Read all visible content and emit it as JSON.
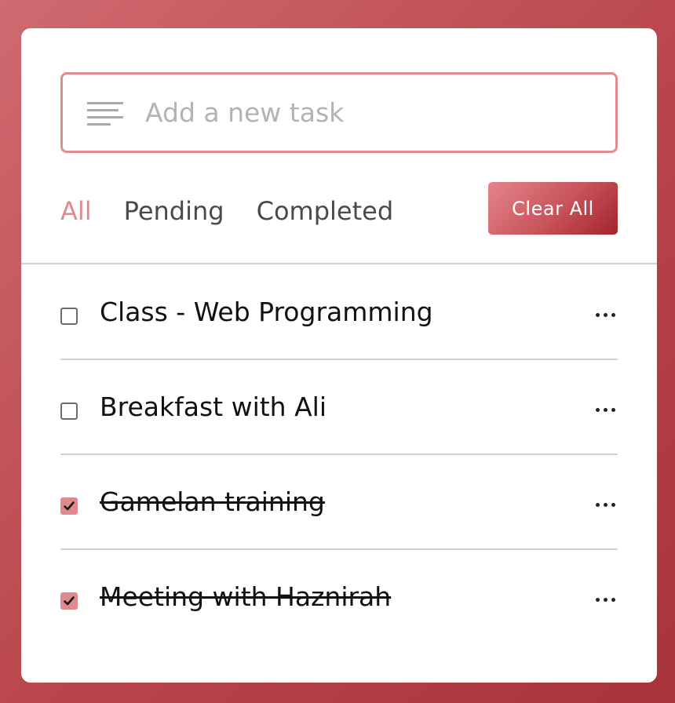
{
  "input": {
    "placeholder": "Add a new task",
    "value": "",
    "icon": "text-lines-icon"
  },
  "filters": [
    {
      "label": "All",
      "active": true
    },
    {
      "label": "Pending",
      "active": false
    },
    {
      "label": "Completed",
      "active": false
    }
  ],
  "clear_all_label": "Clear All",
  "tasks": [
    {
      "text": "Class - Web Programming",
      "completed": false
    },
    {
      "text": "Breakfast with Ali",
      "completed": false
    },
    {
      "text": "Gamelan training",
      "completed": true
    },
    {
      "text": "Meeting with Haznirah",
      "completed": true
    }
  ],
  "colors": {
    "accent": "#e08a8e",
    "button_start": "#e4858b",
    "button_end": "#a2242e",
    "background": "#b9454c"
  }
}
